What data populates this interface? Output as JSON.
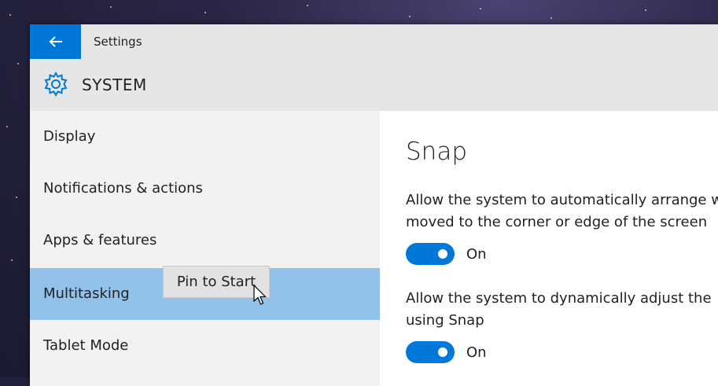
{
  "window": {
    "app_title": "Settings",
    "back_icon": "arrow-left-icon",
    "accent_color": "#0078d7",
    "selection_color": "#92c1ea"
  },
  "header": {
    "icon": "gear-icon",
    "title": "SYSTEM"
  },
  "sidebar": {
    "items": [
      {
        "label": "Display",
        "selected": false
      },
      {
        "label": "Notifications & actions",
        "selected": false
      },
      {
        "label": "Apps & features",
        "selected": false
      },
      {
        "label": "Multitasking",
        "selected": true
      },
      {
        "label": "Tablet Mode",
        "selected": false
      }
    ]
  },
  "context_tooltip": {
    "label": "Pin to Start"
  },
  "content": {
    "section_title": "Snap",
    "settings": [
      {
        "description_line1": "Allow the system to automatically arrange w",
        "description_line2": "moved to the corner or edge of the screen",
        "toggle_state": "On",
        "enabled": true
      },
      {
        "description_line1": "Allow the system to dynamically adjust the",
        "description_line2": "using Snap",
        "toggle_state": "On",
        "enabled": true
      }
    ]
  }
}
